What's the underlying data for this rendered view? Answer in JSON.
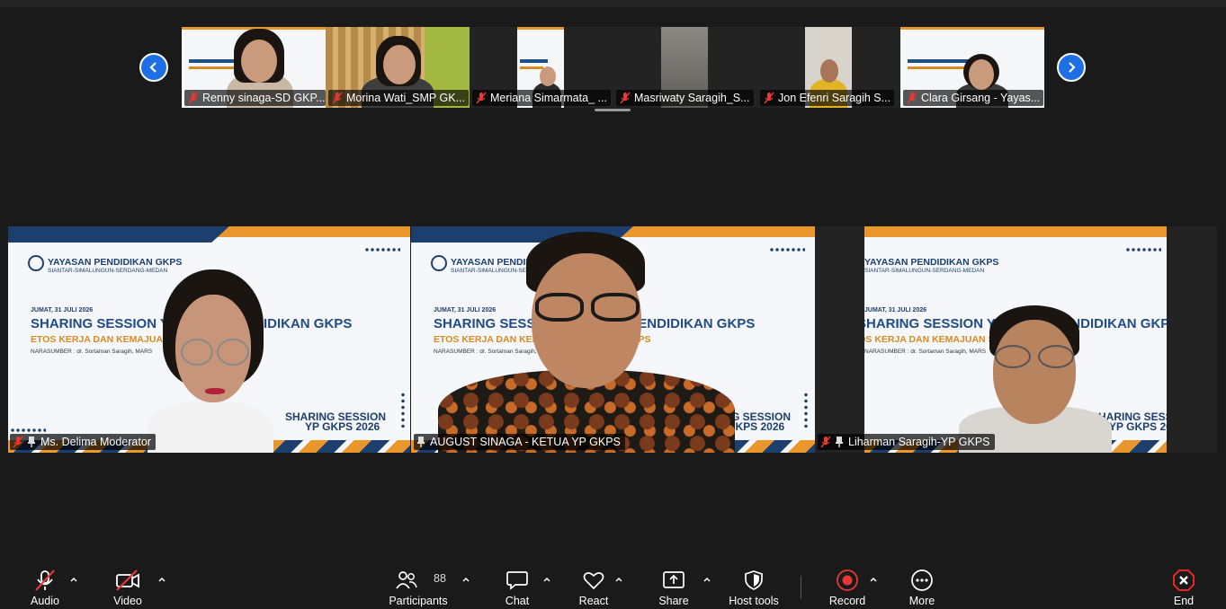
{
  "thumbnails": [
    {
      "name": "Renny sinaga-SD GKP..."
    },
    {
      "name": "Morina Wati_SMP GK..."
    },
    {
      "name": "Meriana Simarmata_ ..."
    },
    {
      "name": "Masriwaty Saragih_S..."
    },
    {
      "name": "Jon Efenri Saragih S..."
    },
    {
      "name": "Clara Girsang - Yayas..."
    }
  ],
  "tiles": [
    {
      "name": "Ms. Delima Moderator",
      "active": false,
      "muted": true
    },
    {
      "name": "AUGUST SINAGA - KETUA YP GKPS",
      "active": true,
      "muted": false
    },
    {
      "name": "Liharman Saragih-YP GKPS",
      "active": false,
      "muted": true
    }
  ],
  "slide": {
    "org": "YAYASAN PENDIDIKAN GKPS",
    "org_sub": "SIANTAR-SIMALUNGUN-SERDANG-MEDAN",
    "date": "JUMAT, 31 JULI 2026",
    "title": "SHARING SESSION YAYASAN PENDIDIKAN GKPS",
    "subtitle": "ETOS KERJA DAN KEMAJUAN SEKOLAH GKPS",
    "speaker": "NARASUMBER : dr. Sortaman Saragih, MARS",
    "badge1": "SHARING SESSION",
    "badge2": "YP GKPS 2026"
  },
  "toolbar": {
    "audio": "Audio",
    "video": "Video",
    "participants": "Participants",
    "participants_count": "88",
    "chat": "Chat",
    "react": "React",
    "share": "Share",
    "host_tools": "Host tools",
    "record": "Record",
    "more": "More",
    "end": "End"
  },
  "colors": {
    "accent_blue": "#1e6fe6",
    "active_speaker": "#27c26a",
    "muted_red": "#e53935",
    "end_red": "#e02828"
  }
}
